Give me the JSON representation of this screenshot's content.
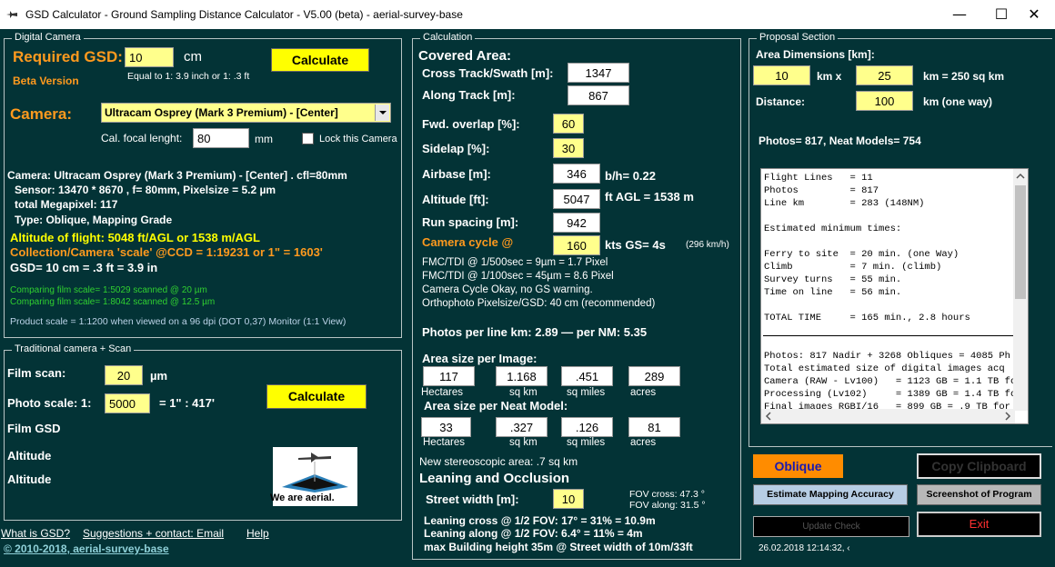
{
  "window": {
    "title": "GSD Calculator - Ground Sampling Distance Calculator - V5.00 (beta) - aerial-survey-base",
    "minimize": "—",
    "maximize": "☐",
    "close": "✕"
  },
  "digital": {
    "legend": "Digital Camera",
    "required_gsd_label": "Required GSD:",
    "gsd_value": "10",
    "gsd_unit": "cm",
    "calculate": "Calculate",
    "equal_to": "Equal to 1: 3.9  inch or 1: .3 ft",
    "beta": "Beta Version",
    "camera_label": "Camera:",
    "camera_value": "Ultracam Osprey (Mark 3 Premium) - [Center]",
    "focal_label": "Cal. focal lenght:",
    "focal_value": "80",
    "focal_unit": "mm",
    "lock_label": "Lock this Camera",
    "info1": "Camera: Ultracam Osprey (Mark 3 Premium) - [Center] . cfl=80mm",
    "info2": "Sensor: 13470 * 8670 , f= 80mm, Pixelsize = 5.2 µm",
    "info3": "total Megapixel: 117",
    "info4": "Type: Oblique, Mapping Grade",
    "altitude_line": "Altitude of flight: 5048 ft/AGL or 1538 m/AGL",
    "collection_line": "Collection/Camera 'scale' @CCD = 1:19231  or 1\" = 1603'",
    "gsd_line": "GSD= 10 cm = .3 ft = 3.9 in",
    "compare1": "Comparing film scale= 1:5029 scanned @ 20   µm",
    "compare2": "Comparing film scale= 1:8042 scanned @ 12.5 µm",
    "product_scale": "Product scale = 1:1200 when viewed on a 96 dpi (DOT 0,37) Monitor (1:1 View)"
  },
  "traditional": {
    "legend": "Traditional camera + Scan",
    "film_scan_label": "Film scan:",
    "film_scan_value": "20",
    "film_scan_unit": "µm",
    "photo_scale_label": "Photo scale: 1:",
    "photo_scale_value": "5000",
    "photo_scale_eq": "= 1\" :  417'",
    "calculate": "Calculate",
    "film_gsd": "Film GSD",
    "altitude1": "Altitude",
    "altitude2": "Altitude",
    "logo_caption": "We  are aerial."
  },
  "footer": {
    "what_is_gsd": "What is GSD?",
    "suggestions": "Suggestions + contact: Email",
    "help": "Help",
    "copyright": "© 2010-2018, aerial-survey-base"
  },
  "calc": {
    "legend": "Calculation",
    "covered_area": "Covered Area:",
    "cross_track_label": "Cross Track/Swath [m]:",
    "cross_track": "1347",
    "along_track_label": "Along Track [m]:",
    "along_track": "867",
    "fwd_overlap_label": "Fwd. overlap [%]:",
    "fwd_overlap": "60",
    "sidelap_label": "Sidelap [%]:",
    "sidelap": "30",
    "airbase_label": "Airbase [m]:",
    "airbase": "346",
    "bh": "b/h= 0.22",
    "altitude_label": "Altitude [ft]:",
    "altitude": "5047",
    "altitude_agl": "ft AGL = 1538 m",
    "run_spacing_label": "Run spacing [m]:",
    "run_spacing": "942",
    "cycle_label": "Camera cycle @",
    "cycle": "160",
    "kts": "kts GS= 4s",
    "kmh": "(296 km/h)",
    "fmc1": "FMC/TDI @ 1/500sec = 9µm = 1.7 Pixel",
    "fmc2": "FMC/TDI @ 1/100sec = 45µm = 8.6 Pixel",
    "cycle_ok": "Camera Cycle Okay, no GS warning.",
    "ortho": "Orthophoto Pixelsize/GSD: 40 cm (recommended)",
    "photos_per_line": "Photos per line km: 2.89 —  per NM: 5.35",
    "area_image_title": "Area size per Image:",
    "area_image": [
      "117",
      "1.168",
      ".451",
      "289"
    ],
    "area_units": [
      "Hectares",
      "sq km",
      "sq miles",
      "acres"
    ],
    "area_neat_title": "Area size per Neat Model:",
    "area_neat": [
      "33",
      ".327",
      ".126",
      "81"
    ],
    "stereo": "New stereoscopic area: .7 sq km",
    "leaning_title": "Leaning and Occlusion",
    "street_label": "Street width [m]:",
    "street": "10",
    "fov_cross": "FOV cross: 47.3 °",
    "fov_along": "FOV along: 31.5 °",
    "lean_cross": "Leaning cross @ 1/2 FOV: 17° = 31% = 10.9m",
    "lean_along": "Leaning along @ 1/2 FOV:  6.4° = 11% = 4m",
    "max_building": "max Building height 35m @ Street width of 10m/33ft"
  },
  "proposal": {
    "legend": "Proposal Section",
    "area_dims_label": "Area Dimensions [km]:",
    "dim1": "10",
    "km_x": "km x",
    "dim2": "25",
    "km_eq": "km = 250 sq km",
    "distance_label": "Distance:",
    "distance": "100",
    "distance_unit": "km (one way)",
    "photos_summary": "Photos= 817, Neat Models= 754",
    "memo_lines": [
      "Flight Lines   = 11",
      "Photos         = 817",
      "Line km        = 283 (148NM)",
      "",
      "Estimated minimum times:",
      "",
      "Ferry to site  = 20 min. (one Way)",
      "Climb          = 7 min. (climb)",
      "Survey turns   = 55 min.",
      "Time on line   = 56 min.",
      "",
      "TOTAL TIME     = 165 min., 2.8 hours",
      "",
      "",
      "Photos: 817 Nadir + 3268 Obliques = 4085 Ph",
      "Total estimated size of digital images acq",
      "Camera (RAW - Lv100)   = 1123 GB = 1.1 TB fo",
      "Processing (Lv102)     = 1389 GB = 1.4 TB fo",
      "Final images RGBI/16   = 899 GB = .9 TB for"
    ],
    "oblique": "Oblique",
    "copy_clipboard": "Copy Clipboard",
    "estimate": "Estimate Mapping Accuracy",
    "screenshot": "Screenshot of Program",
    "update_check": "Update Check",
    "exit": "Exit",
    "datetime": "26.02.2018 12:14:32, ‹"
  },
  "colors": {
    "background": "#033336",
    "accent_orange": "#ff9a1e",
    "accent_yellow": "#ffff00",
    "input_yellow": "#ffff8c",
    "exit_red": "#ff3030"
  }
}
